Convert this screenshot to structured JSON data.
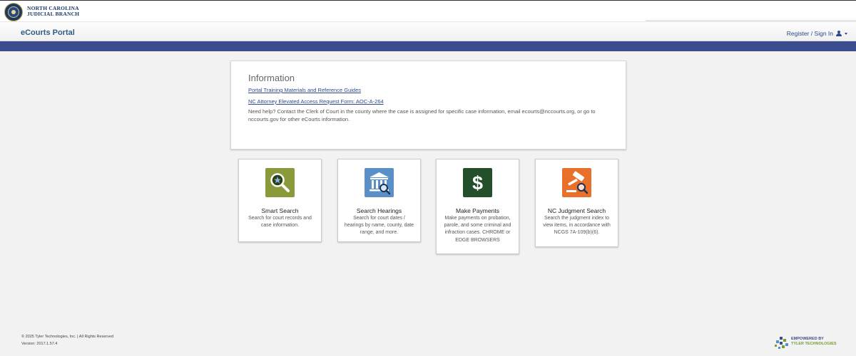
{
  "brand": {
    "line1": "NORTH CAROLINA",
    "line2": "JUDICIAL BRANCH"
  },
  "header": {
    "title": "eCourts Portal",
    "signin_label": "Register / Sign In"
  },
  "info": {
    "title": "Information",
    "link1": "Portal Training Materials and Reference Guides",
    "link2": "NC Attorney Elevated Access Request Form: AOC-A-264",
    "help": "Need help? Contact the Clerk of Court in the county where the case is assigned for specific case information, email ecourts@nccourts.org, or go to nccourts.gov for other eCourts information."
  },
  "tiles": [
    {
      "title": "Smart Search",
      "description": "Search for court records and case information.",
      "icon": "magnifier-star-icon",
      "color": "#8a9a3a"
    },
    {
      "title": "Search Hearings",
      "description": "Search for court dates / hearings by name, county, date range, and more.",
      "icon": "courthouse-search-icon",
      "color": "#5b8fc7"
    },
    {
      "title": "Make Payments",
      "description": "Make payments on probation, parole, and some criminal and infraction cases. CHROME or EDGE BROWSERS",
      "icon": "dollar-icon",
      "color": "#23502a"
    },
    {
      "title": "NC Judgment Search",
      "description": "Search the judgment index to view items, in accordance with NCGS 7A-109(b)(6).",
      "icon": "gavel-search-icon",
      "color": "#e8702a"
    }
  ],
  "footer": {
    "copyright": "© 2025 Tyler Technologies, Inc. | All Rights Reserved",
    "version": "Version: 2017.1.57.4",
    "tyler_line1": "EMPOWERED BY",
    "tyler_line2": "TYLER TECHNOLOGIES"
  },
  "colors": {
    "nav_band": "#3c4d8d",
    "link": "#2c4a8a",
    "title": "#2f5d87"
  }
}
